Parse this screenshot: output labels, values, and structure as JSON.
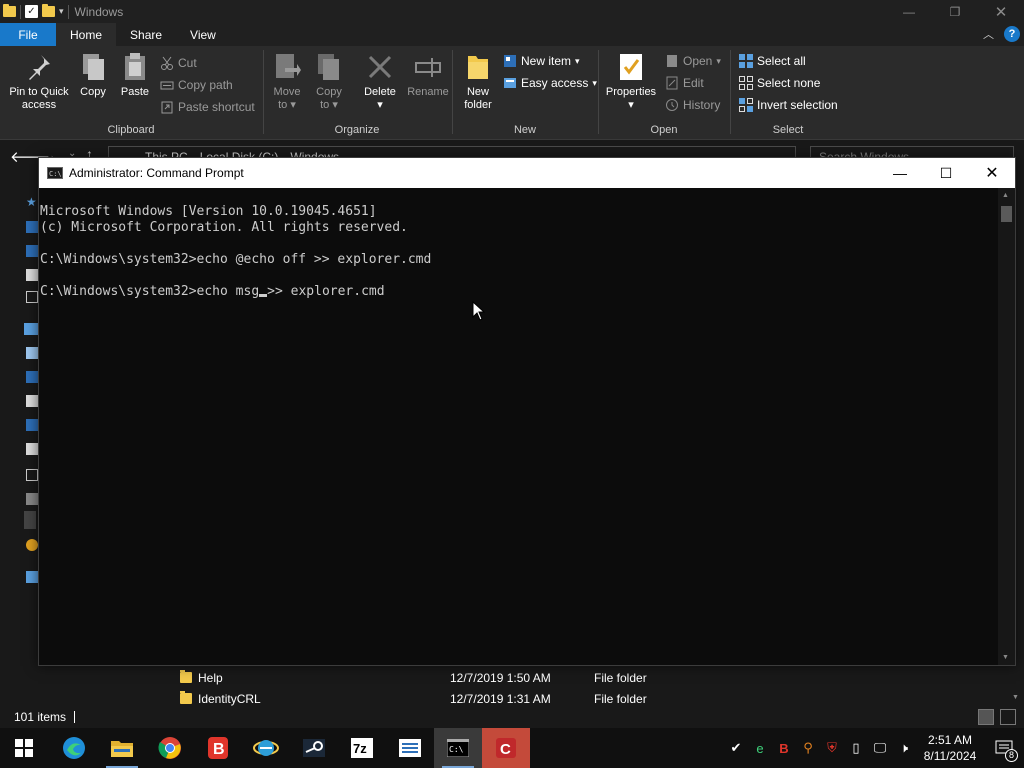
{
  "explorer": {
    "title": "Windows",
    "tabs": [
      {
        "label": "File"
      },
      {
        "label": "Home"
      },
      {
        "label": "Share"
      },
      {
        "label": "View"
      }
    ],
    "ribbon": {
      "clipboard": {
        "label": "Clipboard",
        "pin_line1": "Pin to Quick",
        "pin_line2": "access",
        "copy": "Copy",
        "paste": "Paste",
        "cut": "Cut",
        "copy_path": "Copy path",
        "paste_shortcut": "Paste shortcut"
      },
      "organize": {
        "label": "Organize",
        "move_line1": "Move",
        "move_line2": "to",
        "copy_line1": "Copy",
        "copy_line2": "to",
        "delete": "Delete",
        "rename": "Rename"
      },
      "new": {
        "label": "New",
        "new_folder_line1": "New",
        "new_folder_line2": "folder",
        "new_item": "New item",
        "easy_access": "Easy access"
      },
      "open": {
        "label": "Open",
        "properties": "Properties",
        "open": "Open",
        "edit": "Edit",
        "history": "History"
      },
      "select": {
        "label": "Select",
        "select_all": "Select all",
        "select_none": "Select none",
        "invert_selection": "Invert selection"
      }
    },
    "address": {
      "crumbs": [
        "This PC",
        "Local Disk (C:)",
        "Windows"
      ],
      "search_placeholder": "Search Windows"
    },
    "files": [
      {
        "name": "Help",
        "date": "12/7/2019 1:50 AM",
        "type": "File folder"
      },
      {
        "name": "IdentityCRL",
        "date": "12/7/2019 1:31 AM",
        "type": "File folder"
      }
    ],
    "status": {
      "item_count": "101 items"
    }
  },
  "cmd": {
    "title": "Administrator: Command Prompt",
    "lines": [
      "Microsoft Windows [Version 10.0.19045.4651]",
      "(c) Microsoft Corporation. All rights reserved.",
      "",
      "C:\\Windows\\system32>echo @echo off >> explorer.cmd",
      "",
      "C:\\Windows\\system32>echo msg"
    ],
    "cursor_tail": ">> explorer.cmd"
  },
  "taskbar": {
    "apps": [
      "start-icon",
      "edge-icon",
      "file-explorer-icon",
      "chrome-icon",
      "brave-icon",
      "ie-icon",
      "steam-icon",
      "7zip-icon",
      "notepad-icon",
      "cmd-icon",
      "ccleaner-icon"
    ],
    "clock": {
      "time": "2:51 AM",
      "date": "8/11/2024"
    },
    "notification_count": "8"
  },
  "colors": {
    "accent_blue": "#1979ca",
    "folder_yellow": "#f2c94c",
    "console_bg": "#0c0c0c",
    "console_text": "#cccccc",
    "taskbar_bg": "#101010"
  }
}
